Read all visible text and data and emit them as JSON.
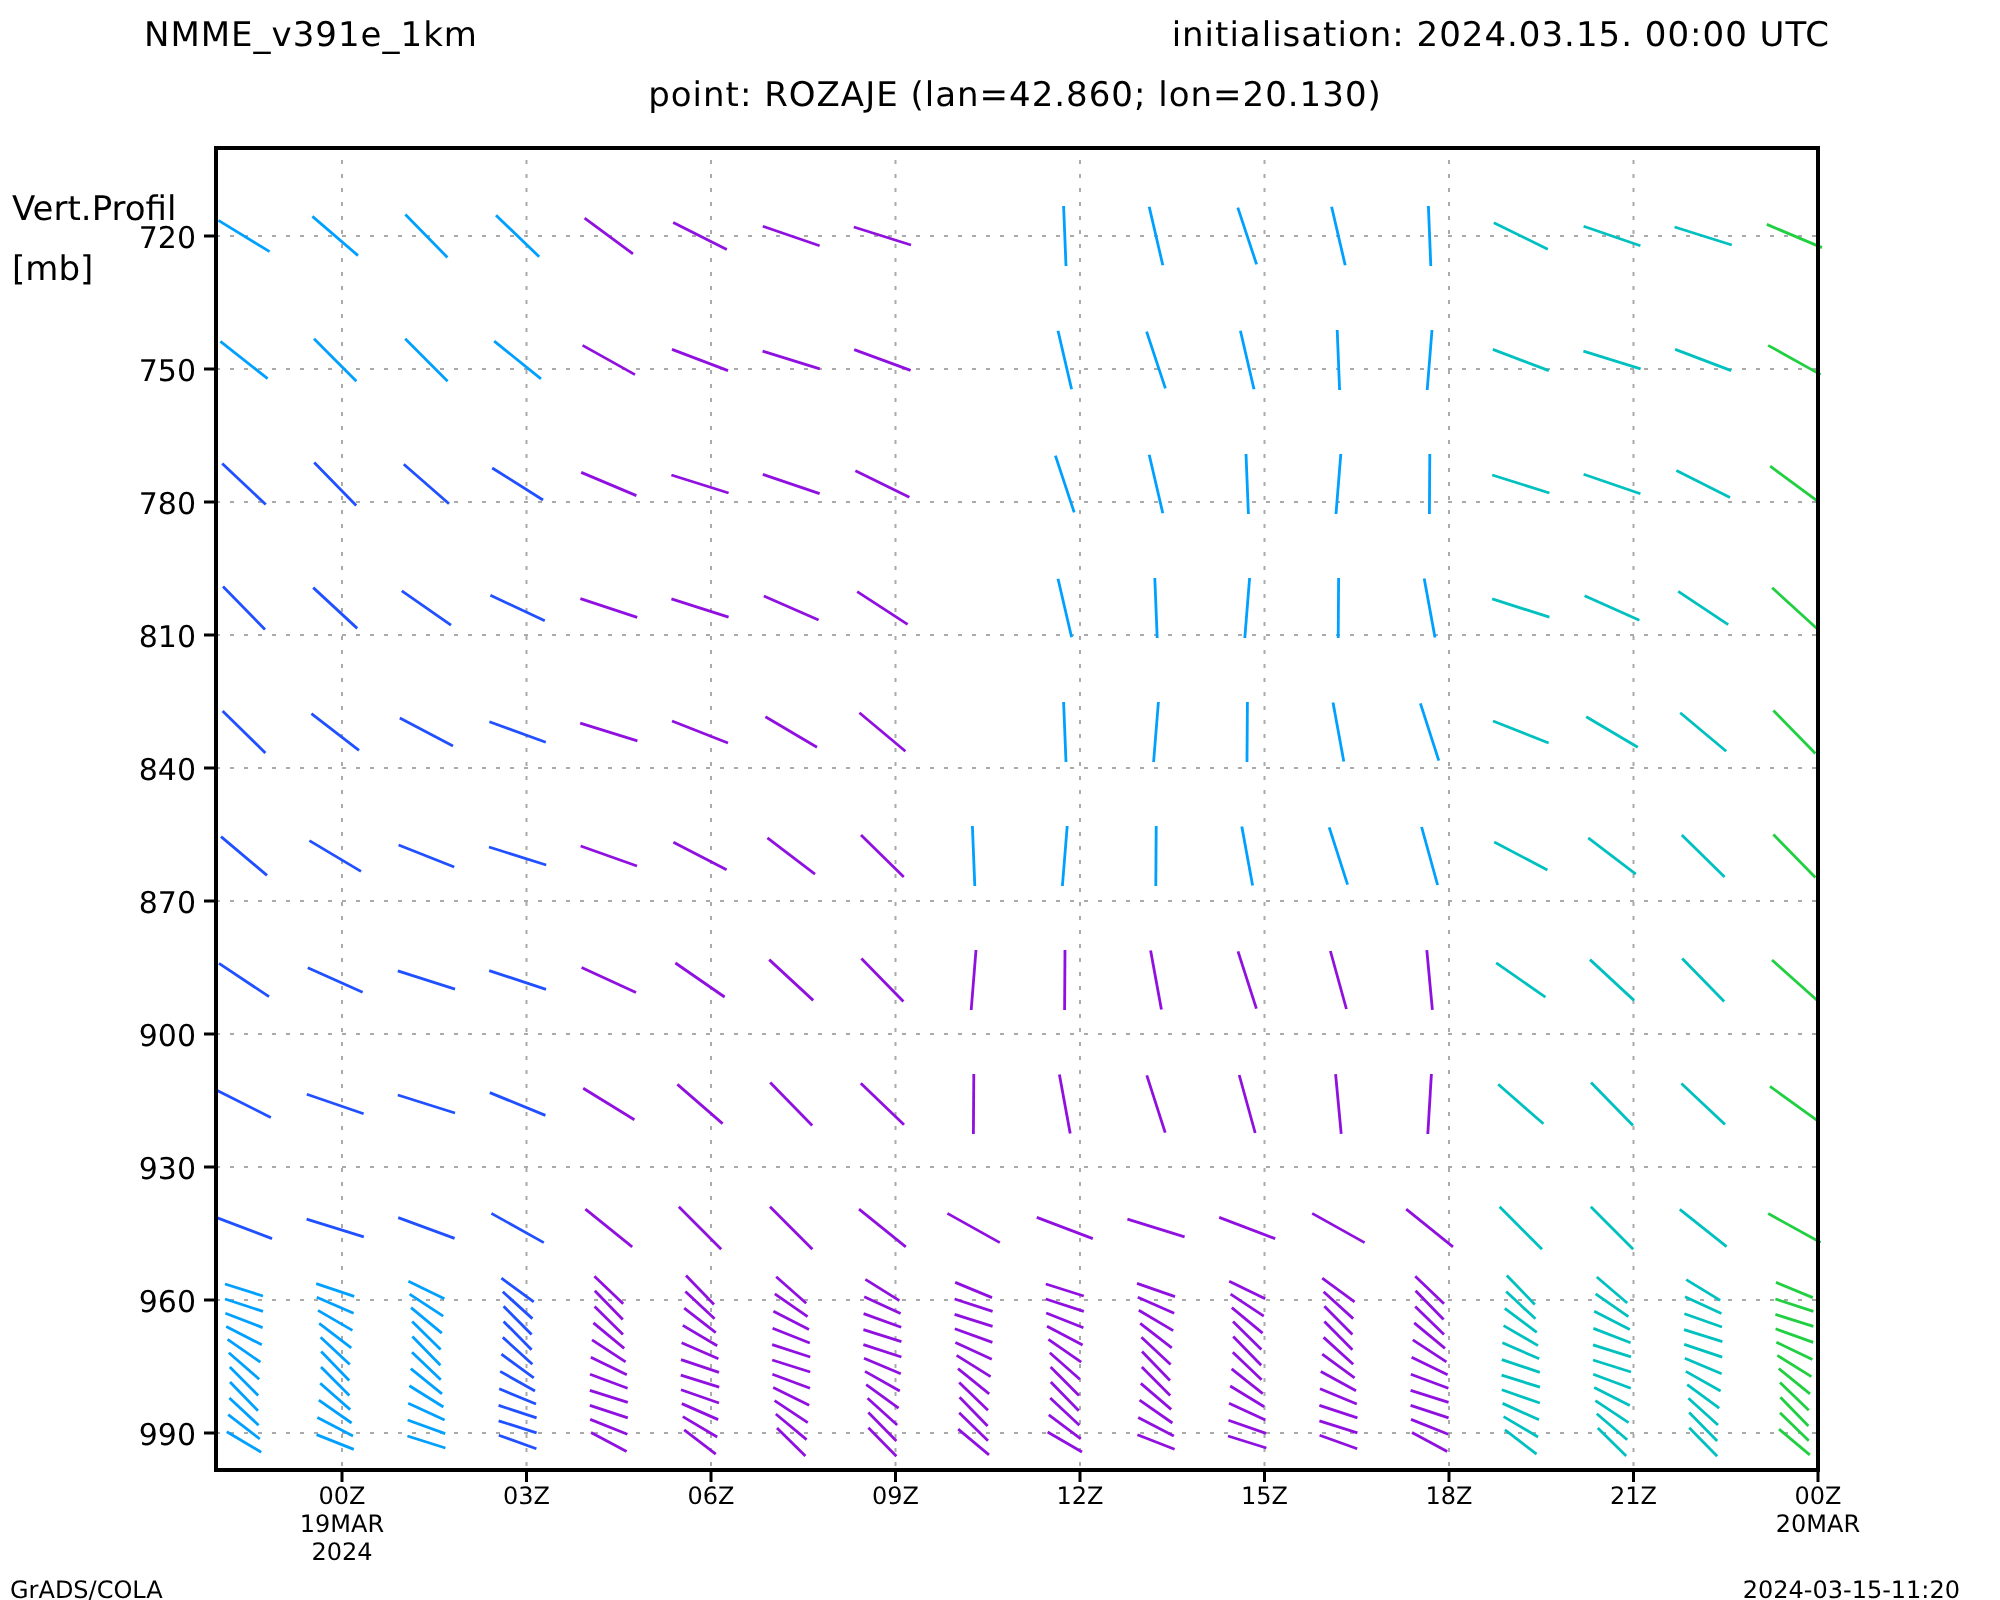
{
  "header": {
    "title": "NMME_v391e_1km",
    "initialisation": "initialisation: 2024.03.15. 00:00 UTC"
  },
  "subtitle": "point: ROZAJE (lan=42.860; lon=20.130)",
  "plot": {
    "y_axis_label": [
      "Vert.Profil",
      "[mb]"
    ],
    "y_ticks": [
      "720",
      "750",
      "780",
      "810",
      "840",
      "870",
      "900",
      "930",
      "960",
      "990"
    ],
    "x_ticks": [
      {
        "label": "00Z",
        "sub": [
          "19MAR",
          "2024"
        ]
      },
      {
        "label": "03Z"
      },
      {
        "label": "06Z"
      },
      {
        "label": "09Z"
      },
      {
        "label": "12Z"
      },
      {
        "label": "15Z"
      },
      {
        "label": "18Z"
      },
      {
        "label": "21Z"
      },
      {
        "label": "00Z",
        "sub": [
          "20MAR"
        ]
      }
    ]
  },
  "footer": {
    "left": "GrADS/COLA",
    "right": "2024-03-15-11:20"
  }
}
